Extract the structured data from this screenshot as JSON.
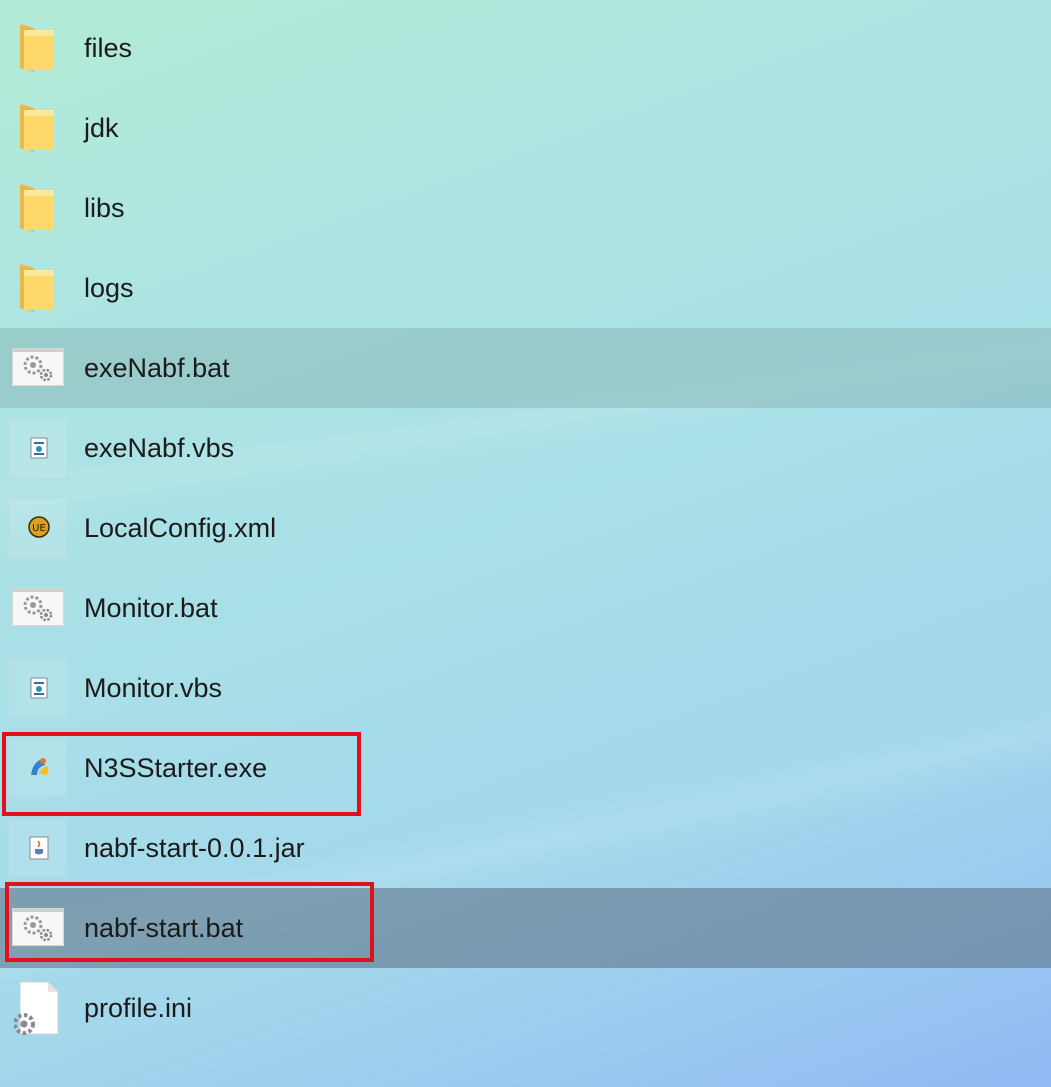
{
  "files": [
    {
      "name": "files",
      "icon": "folder-icon"
    },
    {
      "name": "jdk",
      "icon": "folder-icon"
    },
    {
      "name": "libs",
      "icon": "folder-icon"
    },
    {
      "name": "logs",
      "icon": "folder-icon"
    },
    {
      "name": "exeNabf.bat",
      "icon": "batch-file-icon"
    },
    {
      "name": "exeNabf.vbs",
      "icon": "vbscript-file-icon"
    },
    {
      "name": "LocalConfig.xml",
      "icon": "xml-file-icon"
    },
    {
      "name": "Monitor.bat",
      "icon": "batch-file-icon"
    },
    {
      "name": "Monitor.vbs",
      "icon": "vbscript-file-icon"
    },
    {
      "name": "N3SStarter.exe",
      "icon": "exe-file-icon"
    },
    {
      "name": "nabf-start-0.0.1.jar",
      "icon": "java-jar-icon"
    },
    {
      "name": "nabf-start.bat",
      "icon": "batch-file-icon"
    },
    {
      "name": "profile.ini",
      "icon": "ini-settings-file-icon"
    }
  ],
  "highlight_color": "#e3101b"
}
